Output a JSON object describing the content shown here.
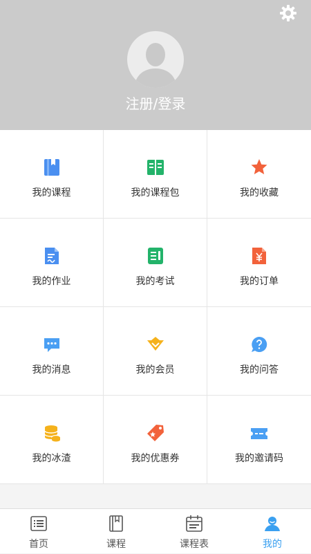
{
  "header": {
    "login_label": "注册/登录",
    "settings_icon": "gear-icon",
    "avatar_icon": "user-avatar-placeholder"
  },
  "menu": {
    "items": [
      {
        "label": "我的课程",
        "icon": "book-icon",
        "color": "#4a8ff0"
      },
      {
        "label": "我的课程包",
        "icon": "open-book-icon",
        "color": "#23b36a"
      },
      {
        "label": "我的收藏",
        "icon": "star-icon",
        "color": "#f2623b"
      },
      {
        "label": "我的作业",
        "icon": "homework-icon",
        "color": "#4a8ff0"
      },
      {
        "label": "我的考试",
        "icon": "exam-icon",
        "color": "#23b36a"
      },
      {
        "label": "我的订单",
        "icon": "order-icon",
        "color": "#f2623b"
      },
      {
        "label": "我的消息",
        "icon": "message-icon",
        "color": "#4a9ff3"
      },
      {
        "label": "我的会员",
        "icon": "vip-diamond-icon",
        "color": "#f5b21c"
      },
      {
        "label": "我的问答",
        "icon": "question-icon",
        "color": "#4a9ff3"
      },
      {
        "label": "我的冰渣",
        "icon": "coins-icon",
        "color": "#f5b21c"
      },
      {
        "label": "我的优惠券",
        "icon": "coupon-tag-icon",
        "color": "#f2623b"
      },
      {
        "label": "我的邀请码",
        "icon": "ticket-icon",
        "color": "#4a9ff3"
      }
    ]
  },
  "tabbar": {
    "tabs": [
      {
        "label": "首页",
        "icon": "home-list-icon"
      },
      {
        "label": "课程",
        "icon": "course-book-icon"
      },
      {
        "label": "课程表",
        "icon": "schedule-icon"
      },
      {
        "label": "我的",
        "icon": "profile-icon",
        "active": true
      }
    ],
    "active_color": "#3aa0f0"
  }
}
